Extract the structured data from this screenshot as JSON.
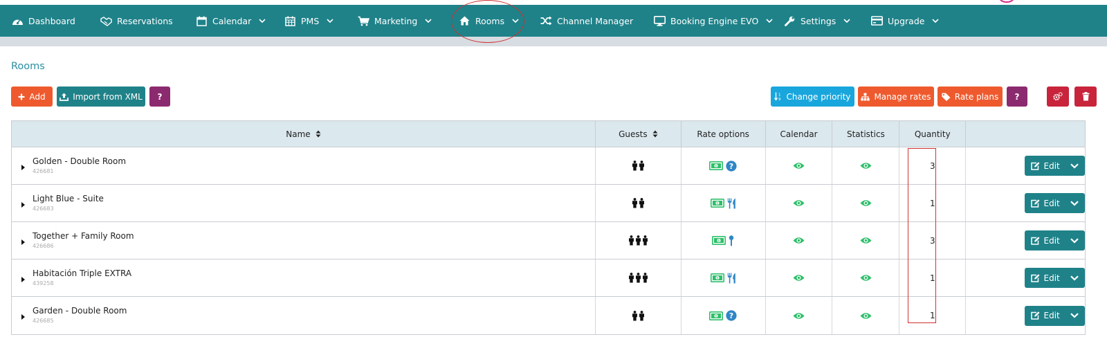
{
  "nav": {
    "items": [
      {
        "label": "Dashboard",
        "icon": "dashboard-icon"
      },
      {
        "label": "Reservations",
        "icon": "handshake-icon"
      },
      {
        "label": "Calendar",
        "icon": "calendar-icon"
      },
      {
        "label": "PMS",
        "icon": "grid-calendar-icon"
      },
      {
        "label": "Marketing",
        "icon": "cart-icon"
      },
      {
        "label": "Rooms",
        "icon": "home-icon"
      },
      {
        "label": "Channel Manager",
        "icon": "shuffle-icon"
      },
      {
        "label": "Booking Engine EVO",
        "icon": "monitor-icon"
      },
      {
        "label": "Settings",
        "icon": "wrench-icon"
      },
      {
        "label": "Upgrade",
        "icon": "credit-card-icon"
      }
    ]
  },
  "page": {
    "title": "Rooms"
  },
  "toolbar": {
    "add": "Add",
    "import": "Import from XML",
    "help": "?",
    "change_priority": "Change priority",
    "manage_rates": "Manage rates",
    "rate_plans": "Rate plans"
  },
  "table": {
    "headers": {
      "name": "Name",
      "guests": "Guests",
      "rate_options": "Rate options",
      "calendar": "Calendar",
      "statistics": "Statistics",
      "quantity": "Quantity"
    },
    "edit_label": "Edit",
    "rows": [
      {
        "name": "Golden - Double Room",
        "id": "426681",
        "guests": 2,
        "rate_icons": [
          "money-icon",
          "question-icon"
        ],
        "quantity": "3"
      },
      {
        "name": "Light Blue - Suite",
        "id": "426683",
        "guests": 2,
        "rate_icons": [
          "money-icon",
          "cutlery-icon"
        ],
        "quantity": "1"
      },
      {
        "name": "Together + Family Room",
        "id": "426686",
        "guests": 3,
        "rate_icons": [
          "money-icon",
          "spoon-icon"
        ],
        "quantity": "3"
      },
      {
        "name": "Habitación Triple EXTRA",
        "id": "439258",
        "guests": 3,
        "rate_icons": [
          "money-icon",
          "cutlery-icon"
        ],
        "quantity": "1"
      },
      {
        "name": "Garden - Double Room",
        "id": "426685",
        "guests": 2,
        "rate_icons": [
          "money-icon",
          "question-icon"
        ],
        "quantity": "1"
      }
    ]
  },
  "colors": {
    "nav": "#1f8289",
    "orange": "#ee5a2e",
    "purple": "#8c2a6f",
    "cyan": "#19a6dd",
    "red": "#c8243c",
    "eye": "#2ebf6a"
  }
}
